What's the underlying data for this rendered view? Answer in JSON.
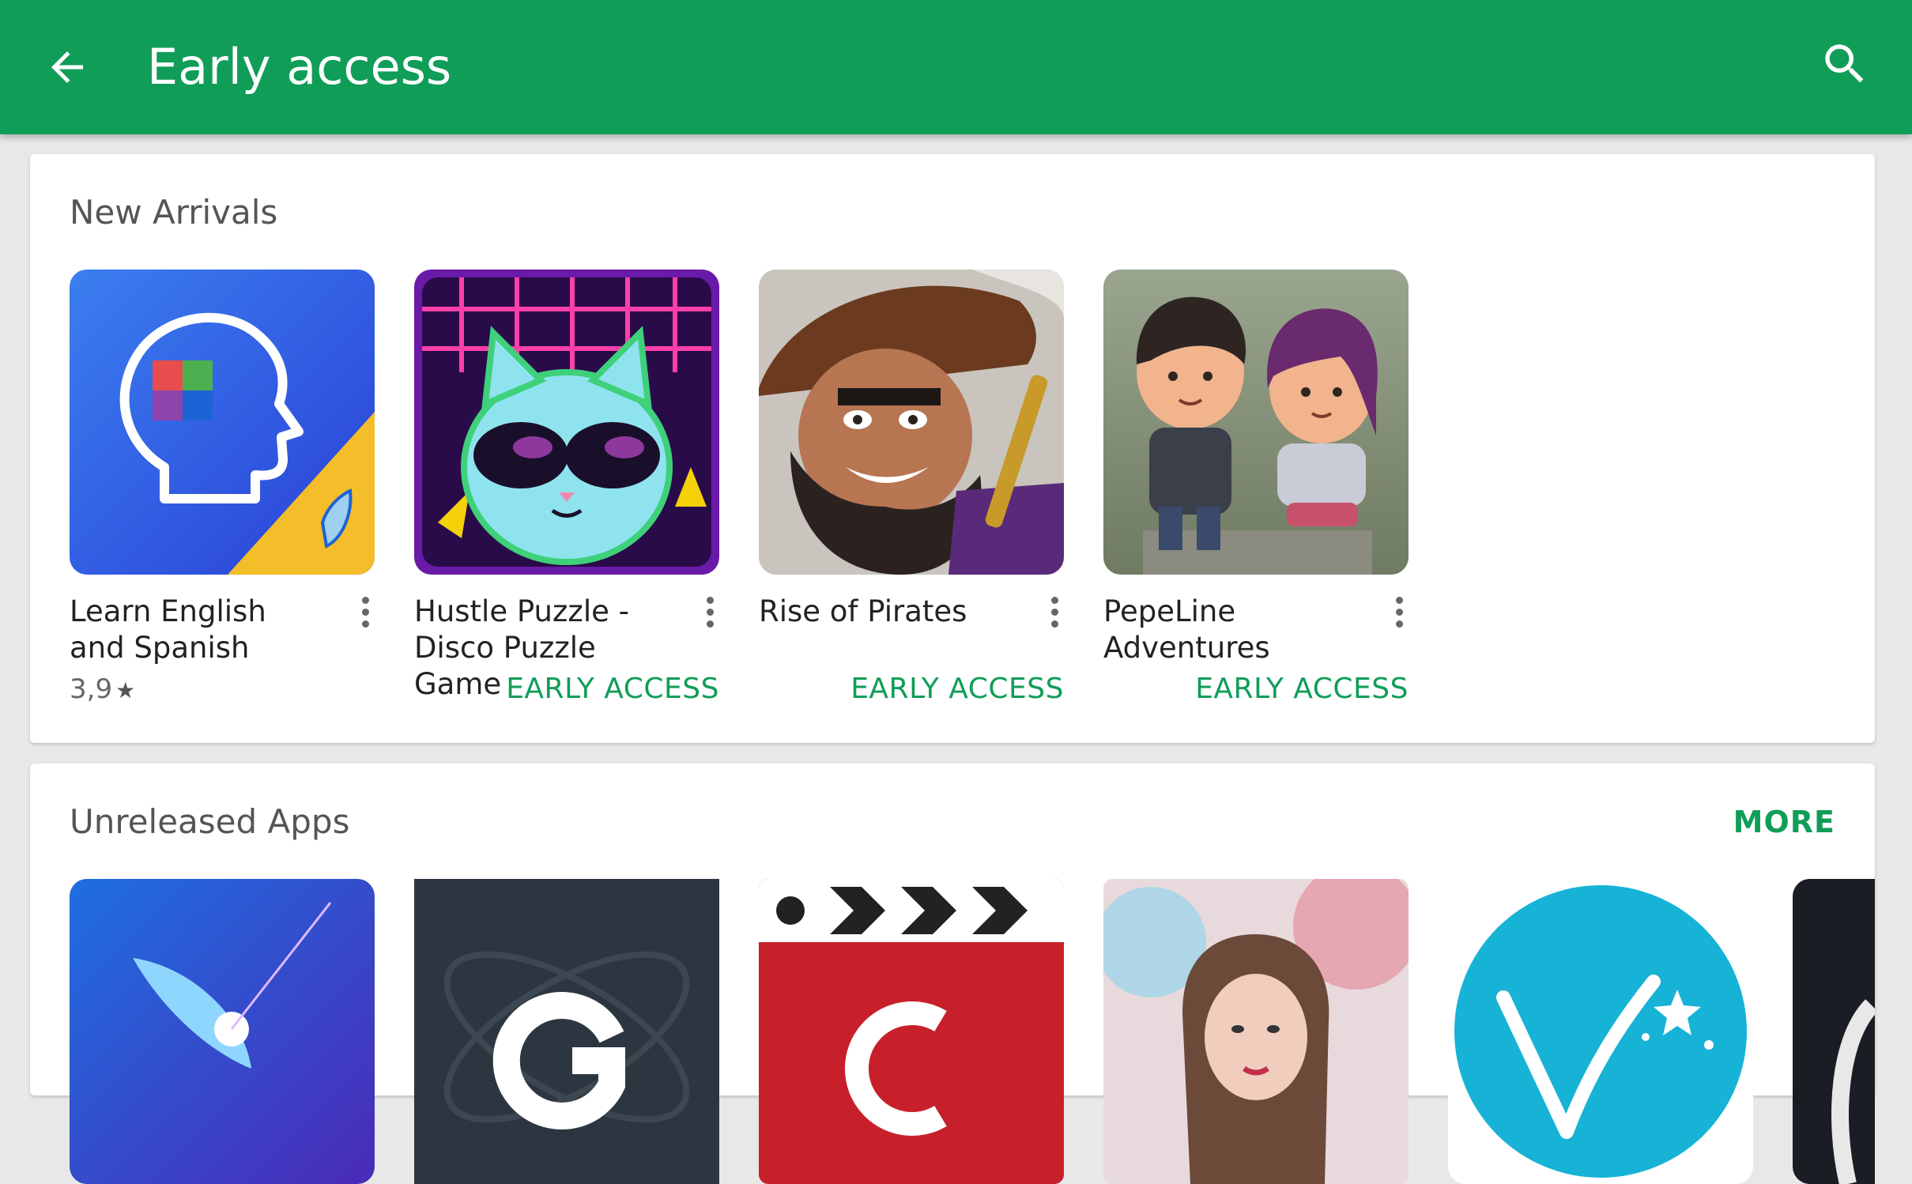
{
  "header": {
    "title": "Early access",
    "back_icon": "arrow-back-icon",
    "search_icon": "search-icon",
    "bg_color": "#109d58"
  },
  "sections": [
    {
      "title": "New Arrivals",
      "apps": [
        {
          "name": "Learn English and Spanish",
          "rating": "3,9",
          "badge": ""
        },
        {
          "name": "Hustle Puzzle - Disco Puzzle Game",
          "rating": "",
          "badge": "EARLY ACCESS"
        },
        {
          "name": "Rise of Pirates",
          "rating": "",
          "badge": "EARLY ACCESS"
        },
        {
          "name": "PepeLine Adventures",
          "rating": "",
          "badge": "EARLY ACCESS"
        }
      ]
    },
    {
      "title": "Unreleased Apps",
      "more_label": "MORE"
    }
  ],
  "accent_color": "#109d58"
}
